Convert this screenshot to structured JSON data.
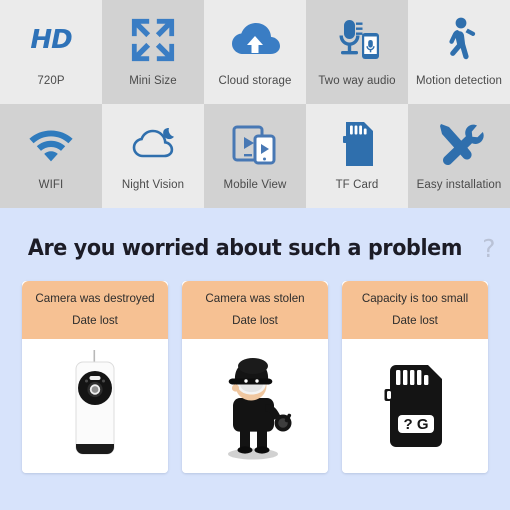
{
  "features": {
    "row1": [
      {
        "label": "720P",
        "icon": "hd-icon",
        "shade": "light"
      },
      {
        "label": "Mini Size",
        "icon": "mini-size-icon",
        "shade": "dark"
      },
      {
        "label": "Cloud storage",
        "icon": "cloud-upload-icon",
        "shade": "light"
      },
      {
        "label": "Two way audio",
        "icon": "microphone-phone-icon",
        "shade": "dark"
      },
      {
        "label": "Motion detection",
        "icon": "walking-person-icon",
        "shade": "light"
      }
    ],
    "row2": [
      {
        "label": "WIFI",
        "icon": "wifi-icon",
        "shade": "dark"
      },
      {
        "label": "Night Vision",
        "icon": "cloud-moon-icon",
        "shade": "light"
      },
      {
        "label": "Mobile View",
        "icon": "tablet-phone-icon",
        "shade": "dark"
      },
      {
        "label": "TF Card",
        "icon": "sd-card-icon",
        "shade": "light"
      },
      {
        "label": "Easy installation",
        "icon": "wrench-screwdriver-icon",
        "shade": "dark"
      }
    ],
    "hd_badge_text": "HD",
    "accent_color": "#2e72b8"
  },
  "problem_section": {
    "headline": "Are you worried about such a problem",
    "headline_question_mark": "?",
    "background_color": "#d7e3fb",
    "card_header_color": "#f6c193",
    "cards": [
      {
        "title": "Camera was destroyed",
        "subtitle": "Date lost",
        "image": "white-ip-camera-photo"
      },
      {
        "title": "Camera was stolen",
        "subtitle": "Date lost",
        "image": "cartoon-thief-illustration"
      },
      {
        "title": "Capacity is too small",
        "subtitle": "Date lost",
        "image": "sd-card-illustration",
        "image_label": "? G"
      }
    ]
  }
}
